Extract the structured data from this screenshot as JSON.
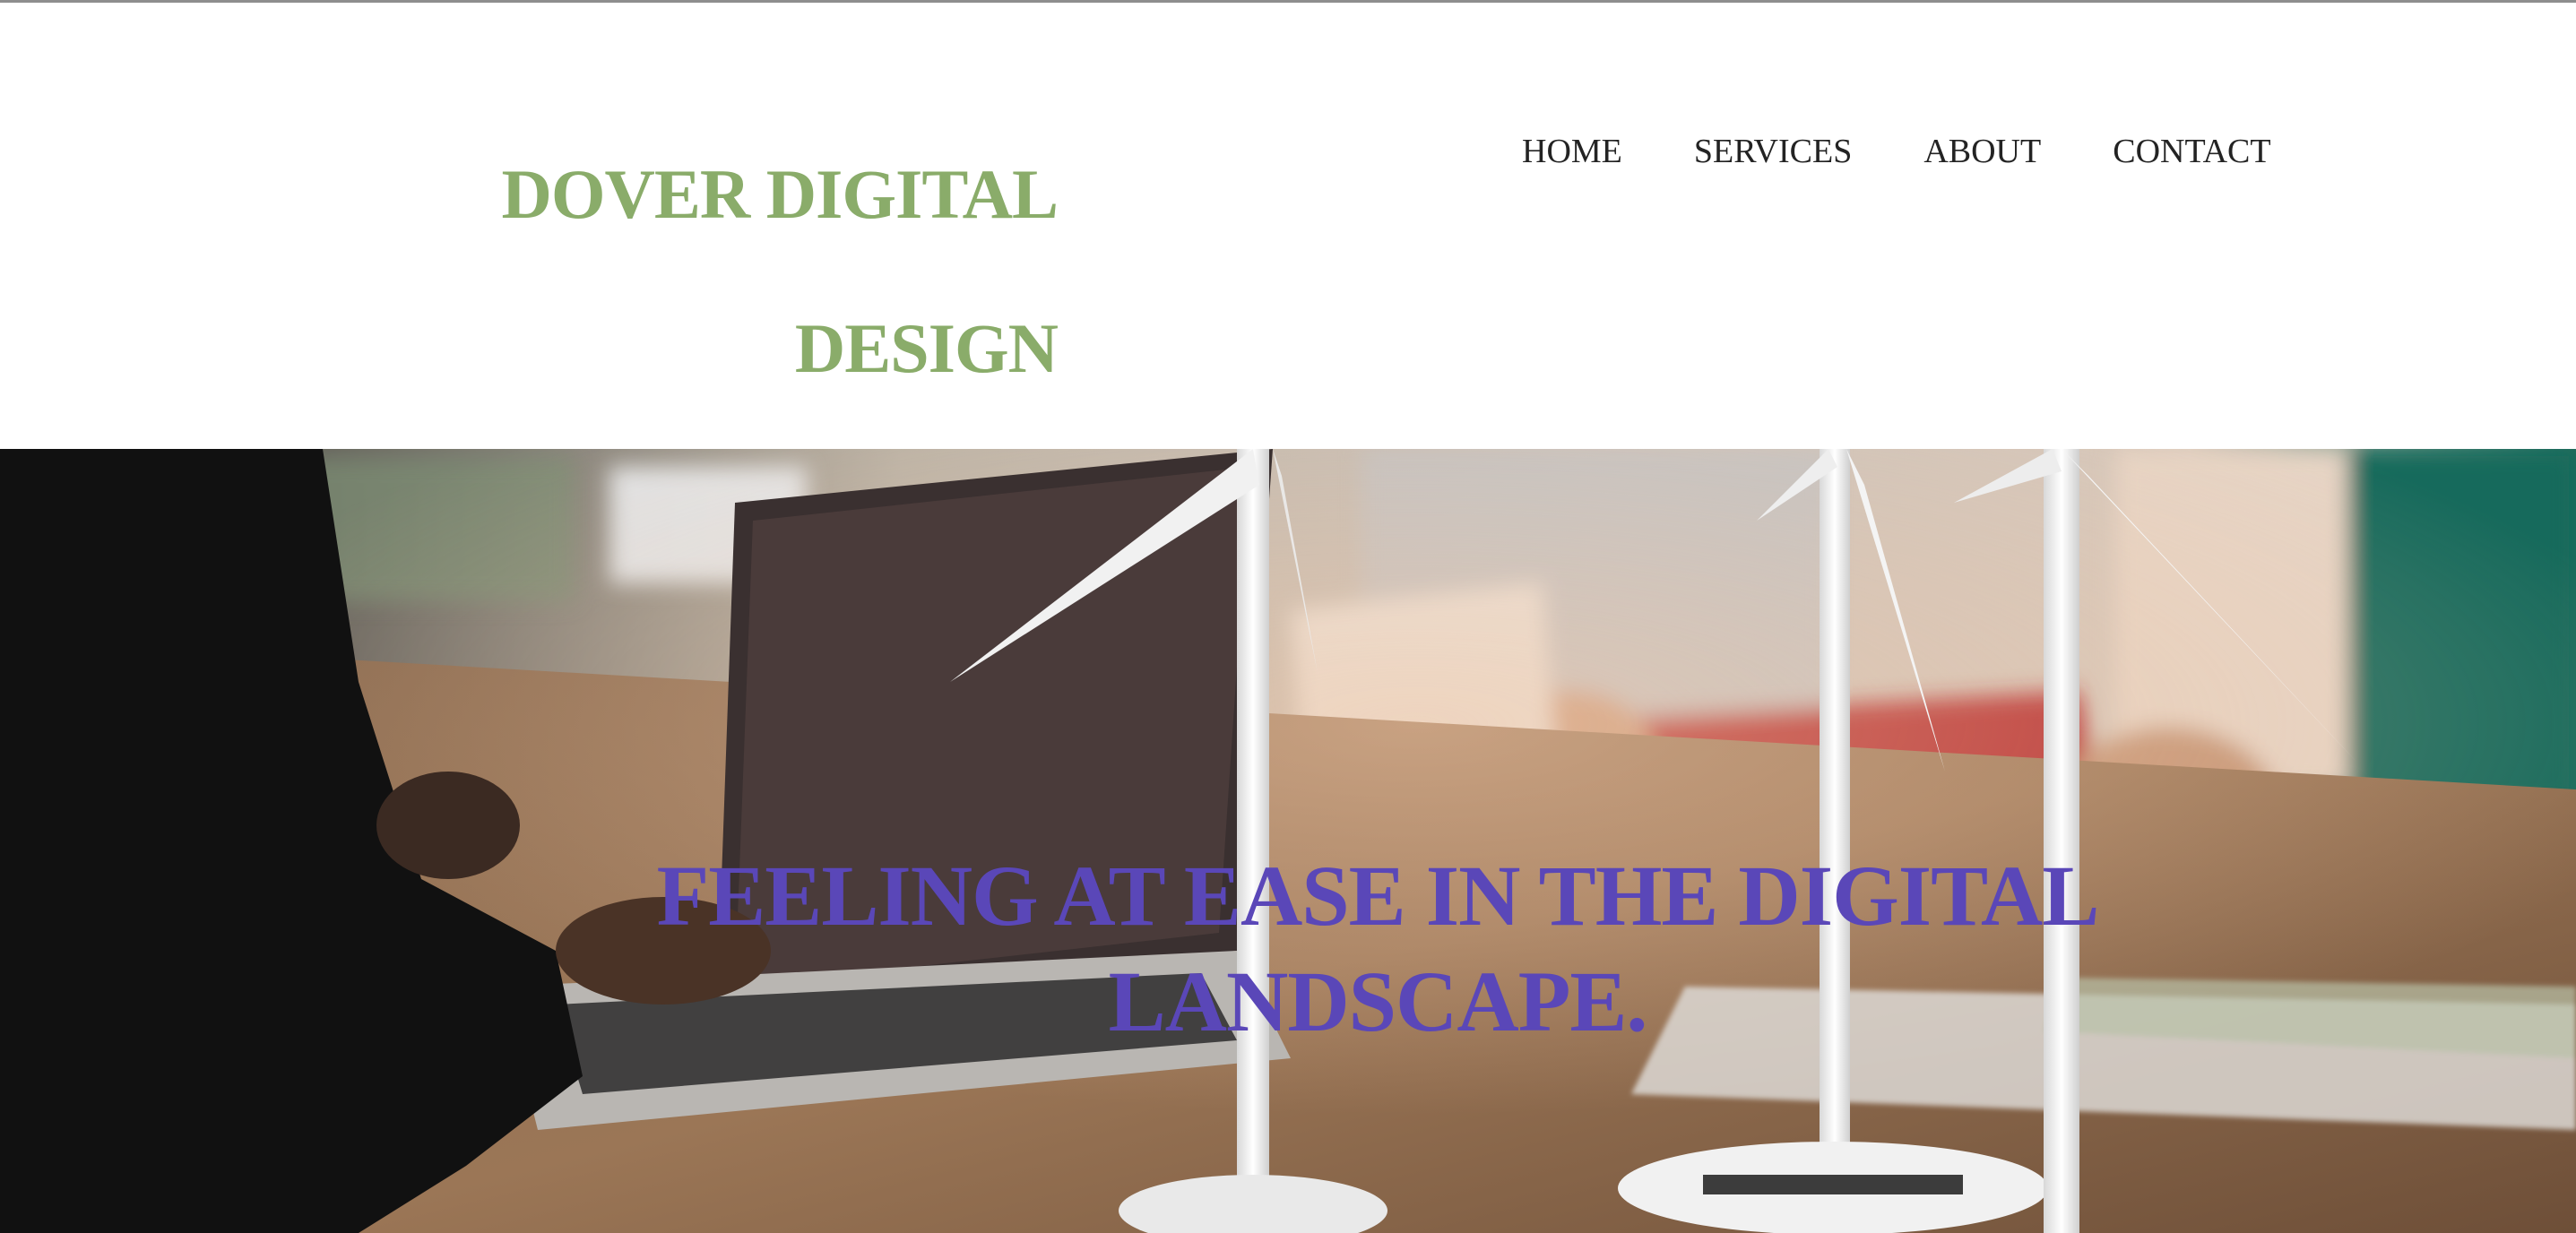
{
  "brand": {
    "line1": "DOVER DIGITAL",
    "line2": "DESIGN",
    "color": "#8aac6a"
  },
  "nav": {
    "items": [
      {
        "label": "HOME"
      },
      {
        "label": "SERVICES"
      },
      {
        "label": "ABOUT"
      },
      {
        "label": "CONTACT"
      }
    ]
  },
  "hero": {
    "title": "FEELING AT EASE IN THE DIGITAL LANDSCAPE.",
    "title_color": "#5a47b8",
    "image": "office-meeting-with-wind-turbine-models"
  }
}
